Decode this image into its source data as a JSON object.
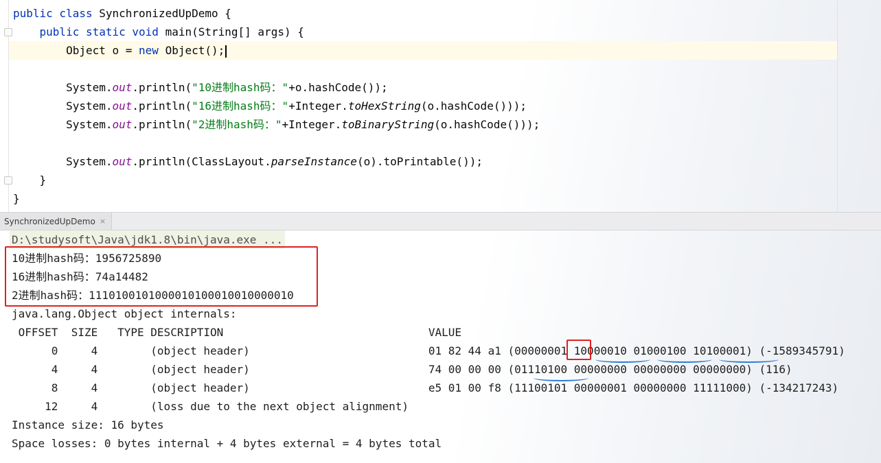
{
  "editor": {
    "lines": [
      {
        "segments": [
          {
            "t": "public class ",
            "c": "kw"
          },
          {
            "t": "SynchronizedUpDemo {",
            "c": ""
          }
        ]
      },
      {
        "segments": [
          {
            "t": "    public static void ",
            "c": "kw"
          },
          {
            "t": "main(String[] args) {",
            "c": ""
          }
        ]
      },
      {
        "segments": [
          {
            "t": "        Object o = ",
            "c": ""
          },
          {
            "t": "new ",
            "c": "kw"
          },
          {
            "t": "Object();",
            "c": ""
          }
        ]
      },
      {
        "segments": []
      },
      {
        "segments": [
          {
            "t": "        System.",
            "c": ""
          },
          {
            "t": "out",
            "c": "fld"
          },
          {
            "t": ".println(",
            "c": ""
          },
          {
            "t": "\"10进制hash码：\"",
            "c": "str"
          },
          {
            "t": "+o.hashCode());",
            "c": ""
          }
        ]
      },
      {
        "segments": [
          {
            "t": "        System.",
            "c": ""
          },
          {
            "t": "out",
            "c": "fld"
          },
          {
            "t": ".println(",
            "c": ""
          },
          {
            "t": "\"16进制hash码：\"",
            "c": "str"
          },
          {
            "t": "+Integer.",
            "c": ""
          },
          {
            "t": "toHexString",
            "c": "ital"
          },
          {
            "t": "(o.hashCode()));",
            "c": ""
          }
        ]
      },
      {
        "segments": [
          {
            "t": "        System.",
            "c": ""
          },
          {
            "t": "out",
            "c": "fld"
          },
          {
            "t": ".println(",
            "c": ""
          },
          {
            "t": "\"2进制hash码：\"",
            "c": "str"
          },
          {
            "t": "+Integer.",
            "c": ""
          },
          {
            "t": "toBinaryString",
            "c": "ital"
          },
          {
            "t": "(o.hashCode()));",
            "c": ""
          }
        ]
      },
      {
        "segments": []
      },
      {
        "segments": [
          {
            "t": "        System.",
            "c": ""
          },
          {
            "t": "out",
            "c": "fld"
          },
          {
            "t": ".println(ClassLayout.",
            "c": ""
          },
          {
            "t": "parseInstance",
            "c": "ital"
          },
          {
            "t": "(o).toPrintable());",
            "c": ""
          }
        ]
      },
      {
        "segments": [
          {
            "t": "    }",
            "c": ""
          }
        ]
      },
      {
        "segments": [
          {
            "t": "}",
            "c": ""
          }
        ]
      }
    ]
  },
  "console_tab": {
    "label": "SynchronizedUpDemo",
    "close": "×"
  },
  "console": {
    "command": "D:\\studysoft\\Java\\jdk1.8\\bin\\java.exe ...",
    "output": [
      "10进制hash码：1956725890",
      "16进制hash码：74a14482",
      "2进制hash码：1110100101000010100010010000010",
      "java.lang.Object object internals:",
      " OFFSET  SIZE   TYPE DESCRIPTION                               VALUE",
      "      0     4        (object header)                           01 82 44 a1 (00000001 10000010 01000100 10100001) (-1589345791)",
      "      4     4        (object header)                           74 00 00 00 (01110100 00000000 00000000 00000000) (116)",
      "      8     4        (object header)                           e5 01 00 f8 (11100101 00000001 00000000 11111000) (-134217243)",
      "     12     4        (loss due to the next object alignment)",
      "Instance size: 16 bytes",
      "Space losses: 0 bytes internal + 4 bytes external = 4 bytes total"
    ]
  },
  "colors": {
    "keyword": "#0033b3",
    "field": "#871094",
    "string": "#067d17",
    "annotation_box": "#e02020",
    "annotation_underline": "#2a7cd8"
  }
}
